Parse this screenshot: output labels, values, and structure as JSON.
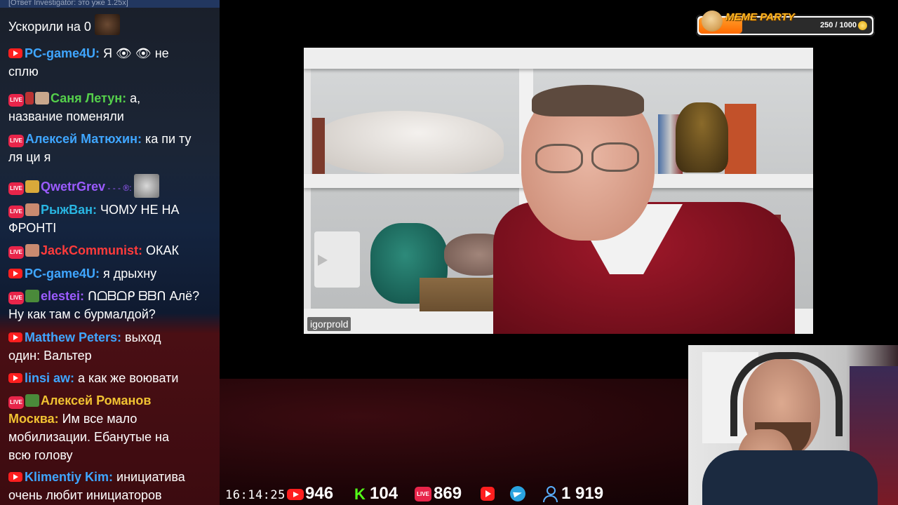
{
  "chat": {
    "reply_context": "[Ответ Investigator: это уже 1.25x]",
    "messages": [
      {
        "platform": "none",
        "username": "",
        "line1": "Ускорили на 0",
        "line2": ""
      },
      {
        "platform": "youtube",
        "username": "PC-game4U:",
        "line1": " Я 👁 👁 не",
        "line2": "сплю"
      },
      {
        "platform": "vk",
        "username": "Саня Летун:",
        "line1": " а,",
        "line2": "название поменяли"
      },
      {
        "platform": "vk",
        "username": "Алексей Матюхин:",
        "line1": " ка пи ту",
        "line2": "ля ци я"
      },
      {
        "platform": "vk",
        "username": "QwetrGrev",
        "line1": "",
        "line2": ""
      },
      {
        "platform": "vk",
        "username": "РыжВан:",
        "line1": " ЧОМУ НЕ НА",
        "line2": "ФРОНТІ"
      },
      {
        "platform": "vk",
        "username": "JackCommunist:",
        "line1": " ОКАК",
        "line2": ""
      },
      {
        "platform": "youtube",
        "username": "PC-game4U:",
        "line1": " я дрыхну",
        "line2": ""
      },
      {
        "platform": "vk",
        "username": "elestei:",
        "line1": " ᑎᗝᗷᗝᑭ ᗷᗷᑎ Алё?",
        "line2": "Ну как там с бурмалдой?"
      },
      {
        "platform": "youtube",
        "username": "Matthew Peters:",
        "line1": " выход",
        "line2": "один: Вальтер"
      },
      {
        "platform": "youtube",
        "username": "linsi aw:",
        "line1": " а как же воювати",
        "line2": ""
      },
      {
        "platform": "vk",
        "username": "Алексей Романов",
        "line1": "",
        "line2": "Москва:",
        "line2b": " Им все мало",
        "line3": "мобилизации. Ебанутые на",
        "line4": "всю голову"
      },
      {
        "platform": "youtube",
        "username": "Klimentiy Kim:",
        "line1": " инициатива",
        "line2": "очень любит инициаторов"
      }
    ]
  },
  "video": {
    "participant_name": "igorprold"
  },
  "meme_party": {
    "title": "MEME PARTY",
    "progress_text": "250 / 1000",
    "current": 250,
    "max": 1000
  },
  "stats": {
    "clock": "16:14:25",
    "youtube_count": "946",
    "kick_count": "104",
    "vk_live_count": "869",
    "total_viewers": "1 919"
  },
  "colors": {
    "youtube": "#ff1f1f",
    "vk_live": "#e8254a",
    "kick": "#53fc18",
    "telegram": "#2aa3e0",
    "viewers": "#5ab0ff"
  }
}
